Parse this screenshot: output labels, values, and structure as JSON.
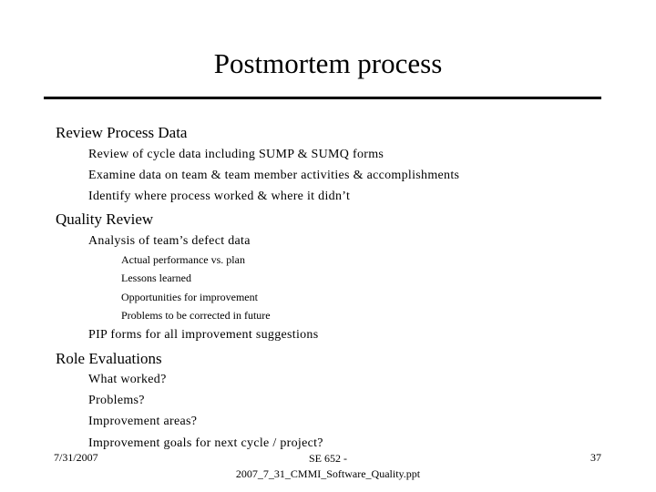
{
  "slide": {
    "title": "Postmortem process",
    "sections": [
      {
        "heading": "Review Process Data",
        "items": [
          {
            "text": "Review of cycle data including SUMP & SUMQ forms",
            "subitems": []
          },
          {
            "text": "Examine data on team & team member activities & accomplishments",
            "subitems": []
          },
          {
            "text": "Identify where process worked & where it didn’t",
            "subitems": []
          }
        ]
      },
      {
        "heading": "Quality Review",
        "items": [
          {
            "text": "Analysis of team’s defect data",
            "subitems": [
              "Actual performance vs. plan",
              "Lessons learned",
              "Opportunities for improvement",
              "Problems to be corrected in future"
            ]
          },
          {
            "text": "PIP forms for all improvement suggestions",
            "subitems": []
          }
        ]
      },
      {
        "heading": "Role Evaluations",
        "items": [
          {
            "text": "What worked?",
            "subitems": []
          },
          {
            "text": "Problems?",
            "subitems": []
          },
          {
            "text": "Improvement areas?",
            "subitems": []
          },
          {
            "text": "Improvement goals for next cycle / project?",
            "subitems": []
          }
        ]
      }
    ]
  },
  "footer": {
    "date": "7/31/2007",
    "center_line1": "SE 652 -",
    "center_line2": "2007_7_31_CMMI_Software_Quality.ppt",
    "page_number": "37"
  }
}
